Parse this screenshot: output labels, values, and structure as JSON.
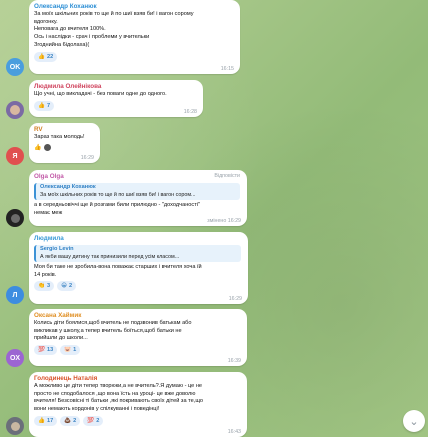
{
  "messages": [
    {
      "name": "Олександр Коханюк",
      "lines": [
        "За моїх шкільних років то ще й по шиї взяв би! і вагон сорому",
        "вдогонку.",
        "Неповага до вчителя 100%.",
        "Ось і наслідки - срач і проблеми у вчительки",
        "Згоднийна 6ідолаха)("
      ],
      "r1": "22",
      "time": "16:15",
      "avatar": "OK"
    },
    {
      "name": "Людмила Олейнікова",
      "lines": [
        "Що учні, що викладачі - без поваги одне до одного."
      ],
      "r1": "7",
      "time": "16:28"
    },
    {
      "name": "RV",
      "lines": [
        "Зараз така молодь!"
      ],
      "time": "16:29",
      "avatar": "Я"
    },
    {
      "name": "Olga Olga",
      "reply_label": "Відповісти",
      "reply_name": "Олександр Коханюк",
      "reply_text": "За моїх шкільних років то ще й по шиї взяв би! і вагон сором...",
      "lines": [
        "а в середньовіччі ще й розгами били прилюдно - \"доходчаності\"",
        "немає меж"
      ],
      "time": "змінено 16:29"
    },
    {
      "name": "Людмила",
      "reply_name": "Sergio Levin",
      "reply_text": "А якби вашу дитину так принизили перед усім класом...",
      "lines": [
        "Моя би таке не зробила-вона поважає старших і вчителя хоча їй",
        "14 років."
      ],
      "r1": "3",
      "r2": "2",
      "time": "16:29",
      "avatar": "Л"
    },
    {
      "name": "Оксана Хаймик",
      "lines": [
        "Колись діти боялися,щоб вчитель не подзвонив батькам або",
        "викликав у школу,а тепер вчитель боїться,щоб батьки не",
        "прийшли до школи..."
      ],
      "r1": "13",
      "r2": "1",
      "time": "16:39",
      "avatar": "OX"
    },
    {
      "name": "Голодинець Наталія",
      "lines": [
        "А можливо це діти тепер творюки,а не вчитель?.Я думаю - це не",
        "просто не сподобалося ,що вона їсть на уроці- це вже доволю",
        "вчителя! Безсовісні ті батьки ,які покривають своїх дітей за те,що",
        "вони немають кордонів у спілкуванні і поведінці!"
      ],
      "r1": "17",
      "r2": "2",
      "r3": "2",
      "time": "16:43"
    }
  ],
  "colors": {
    "name0": "#2d8fd5",
    "name1": "#d0455f",
    "name2": "#d08024",
    "name3": "#c25aa8",
    "name4": "#3a9bd7",
    "name5": "#e08f24",
    "name6": "#d8532c"
  }
}
